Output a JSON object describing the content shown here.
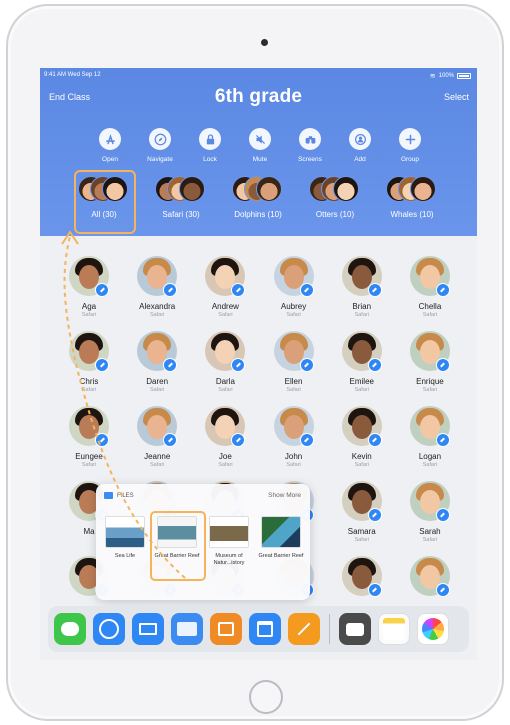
{
  "status_bar": {
    "time": "9:41 AM  Wed Sep 12",
    "battery": "100%"
  },
  "header": {
    "left_button": "End Class",
    "title": "6th grade",
    "right_button": "Select"
  },
  "actions": [
    {
      "label": "Open",
      "icon": "app-store-icon"
    },
    {
      "label": "Navigate",
      "icon": "compass-icon"
    },
    {
      "label": "Lock",
      "icon": "lock-icon"
    },
    {
      "label": "Mute",
      "icon": "mute-icon"
    },
    {
      "label": "Screens",
      "icon": "binoculars-icon"
    },
    {
      "label": "Add",
      "icon": "add-person-icon"
    },
    {
      "label": "Group",
      "icon": "plus-icon"
    }
  ],
  "groups": [
    {
      "label": "All (30)",
      "selected": true
    },
    {
      "label": "Safari (30)",
      "selected": false
    },
    {
      "label": "Dolphins (10)",
      "selected": false
    },
    {
      "label": "Otters (10)",
      "selected": false
    },
    {
      "label": "Whales (10)",
      "selected": false
    }
  ],
  "students": [
    [
      {
        "name": "Aga",
        "app": "Safari"
      },
      {
        "name": "Alexandra",
        "app": "Safari"
      },
      {
        "name": "Andrew",
        "app": "Safari"
      },
      {
        "name": "Aubrey",
        "app": "Safari"
      },
      {
        "name": "Brian",
        "app": "Safari"
      },
      {
        "name": "Chella",
        "app": "Safari"
      }
    ],
    [
      {
        "name": "Chris",
        "app": "Safari"
      },
      {
        "name": "Daren",
        "app": "Safari"
      },
      {
        "name": "Darla",
        "app": "Safari"
      },
      {
        "name": "Ellen",
        "app": "Safari"
      },
      {
        "name": "Emilee",
        "app": "Safari"
      },
      {
        "name": "Enrique",
        "app": "Safari"
      }
    ],
    [
      {
        "name": "Eungee",
        "app": "Safari"
      },
      {
        "name": "Jeanne",
        "app": "Safari"
      },
      {
        "name": "Joe",
        "app": "Safari"
      },
      {
        "name": "John",
        "app": "Safari"
      },
      {
        "name": "Kevin",
        "app": "Safari"
      },
      {
        "name": "Logan",
        "app": "Safari"
      }
    ],
    [
      {
        "name": "Ma",
        "app": ""
      },
      {
        "name": "",
        "app": ""
      },
      {
        "name": "",
        "app": ""
      },
      {
        "name": "fi",
        "app": ""
      },
      {
        "name": "Samara",
        "app": "Safari"
      },
      {
        "name": "Sarah",
        "app": "Safari"
      }
    ],
    [
      {
        "name": "",
        "app": ""
      },
      {
        "name": "",
        "app": ""
      },
      {
        "name": "",
        "app": ""
      },
      {
        "name": "",
        "app": ""
      },
      {
        "name": "",
        "app": ""
      },
      {
        "name": "",
        "app": ""
      }
    ]
  ],
  "files_popover": {
    "title": "FILES",
    "show_more": "Show More",
    "items": [
      {
        "label": "Sea Life",
        "selected": false
      },
      {
        "label": "Great Barrier Reef",
        "selected": true
      },
      {
        "label": "Museum of Natur...istory",
        "selected": false
      },
      {
        "label": "Great Barrier Reef",
        "selected": false
      }
    ]
  },
  "dock": [
    {
      "name": "messages-icon",
      "color": "#3ec64b"
    },
    {
      "name": "safari-icon",
      "color": "#2f86f5"
    },
    {
      "name": "mail-icon",
      "color": "#2f86f5"
    },
    {
      "name": "files-icon",
      "color": "#3b8bf0"
    },
    {
      "name": "keynote-remote-icon",
      "color": "#f08a24"
    },
    {
      "name": "keynote-icon",
      "color": "#2f86f5"
    },
    {
      "name": "pages-icon",
      "color": "#f39a1f"
    },
    {
      "name": "camera-icon",
      "color": "#4a4a4a"
    },
    {
      "name": "notes-icon",
      "color": "#fbfbfb"
    },
    {
      "name": "photos-icon",
      "color": "#ffffff"
    }
  ],
  "colors": {
    "header": "#5b88e3",
    "highlight": "#f5b35a",
    "badge": "#2f86f5"
  }
}
